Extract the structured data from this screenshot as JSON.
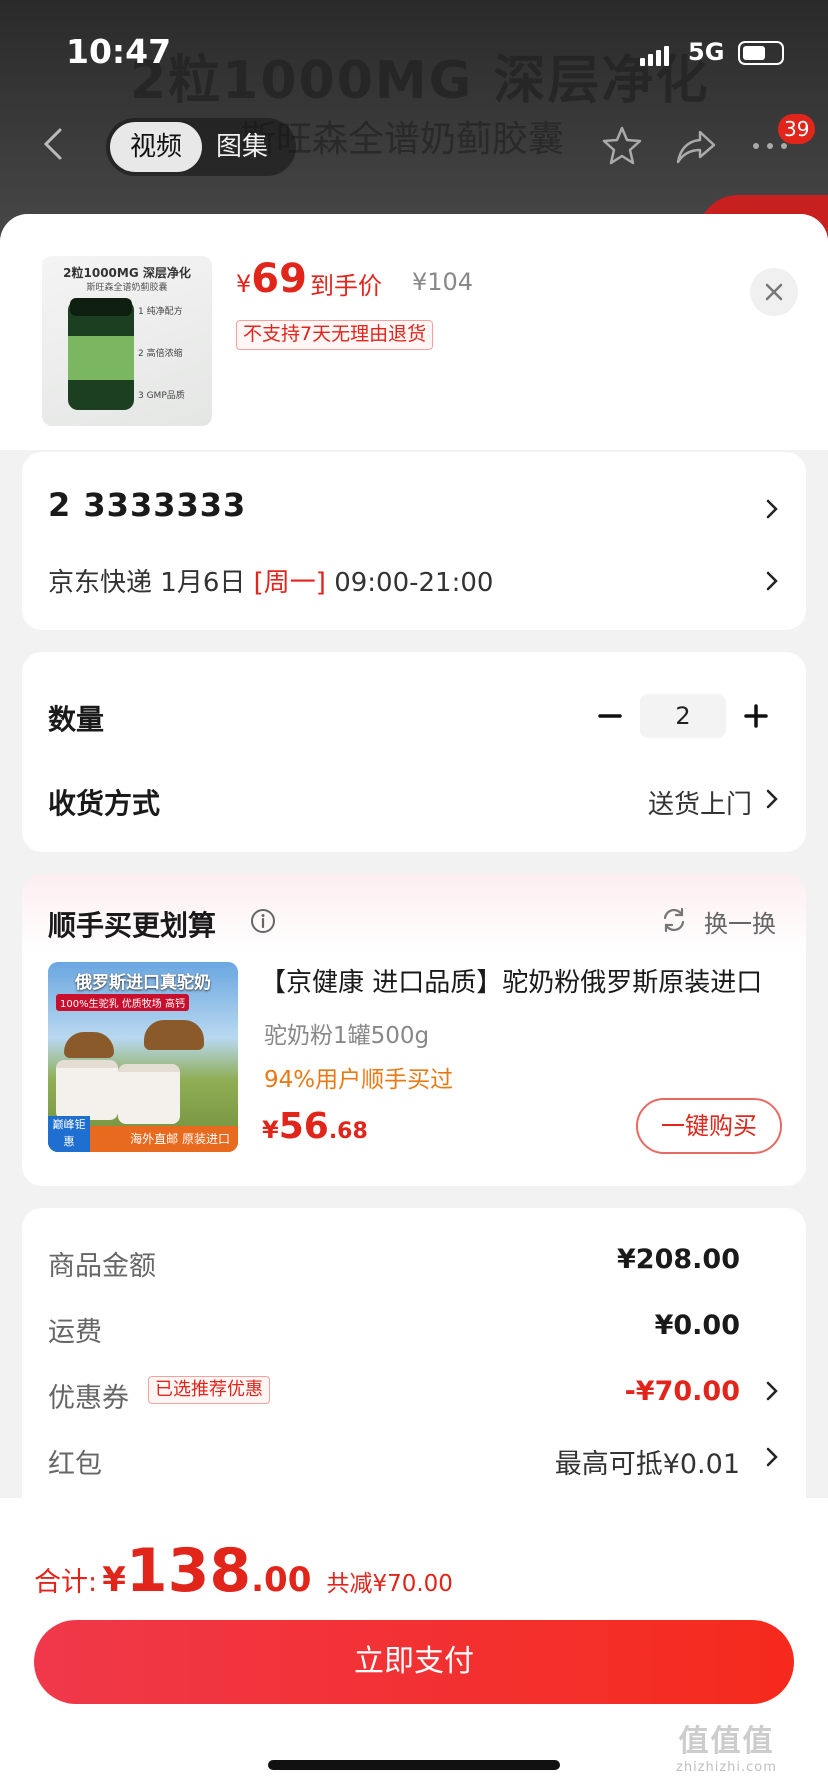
{
  "status_bar": {
    "time": "10:47",
    "network": "5G"
  },
  "background_page": {
    "headline": "2粒1000MG 深层净化",
    "subline": "斯旺森全谱奶蓟胶囊",
    "segment_tabs": [
      "视频",
      "图集"
    ],
    "cart_badge": "39"
  },
  "product": {
    "thumb_title": "2粒1000MG 深层净化",
    "thumb_subtitle": "斯旺森全谱奶蓟胶囊",
    "thumb_features": [
      "1 纯净配方",
      "2 高倍浓缩",
      "3 GMP品质"
    ],
    "price_symbol": "¥",
    "price": "69",
    "price_tag": "到手价",
    "original_price": "¥104",
    "no_return_notice": "不支持7天无理由退货"
  },
  "address": {
    "line1": "2  3333333",
    "courier": "京东快递",
    "date": "1月6日",
    "weekday": "[周一]",
    "time_window": "09:00-21:00"
  },
  "order_options": {
    "quantity_label": "数量",
    "quantity": "2",
    "delivery_label": "收货方式",
    "delivery_value": "送货上门"
  },
  "recommend": {
    "title": "顺手买更划算",
    "swap_label": "换一换",
    "item": {
      "img_title": "俄罗斯进口真驼奶",
      "img_tags": "100%生驼乳 优质牧场 高钙",
      "img_footer": "海外直邮 原装进口",
      "img_badge": "巅峰钜惠",
      "name": "【京健康 进口品质】驼奶粉俄罗斯原装进口",
      "spec": "驼奶粉1罐500g",
      "bought": "94%用户顺手买过",
      "price_symbol": "¥",
      "price_int": "56",
      "price_dec": ".68",
      "buy_label": "一键购买"
    }
  },
  "summary": {
    "rows": [
      {
        "label": "商品金额",
        "value": "¥208.00"
      },
      {
        "label": "运费",
        "value": "¥0.00"
      },
      {
        "label": "优惠券",
        "tag": "已选推荐优惠",
        "value": "-¥70.00"
      },
      {
        "label": "红包",
        "value": "最高可抵¥0.01"
      }
    ]
  },
  "footer": {
    "total_label": "合计:",
    "total_symbol": "¥",
    "total_int": "138",
    "total_dec": ".00",
    "savings": "共减¥70.00",
    "pay_label": "立即支付",
    "watermark_text": "zhizhizhi.com"
  },
  "colors": {
    "accent": "#e1251b",
    "pay_gradient_start": "#f0384a",
    "pay_gradient_end": "#f52a1c"
  }
}
